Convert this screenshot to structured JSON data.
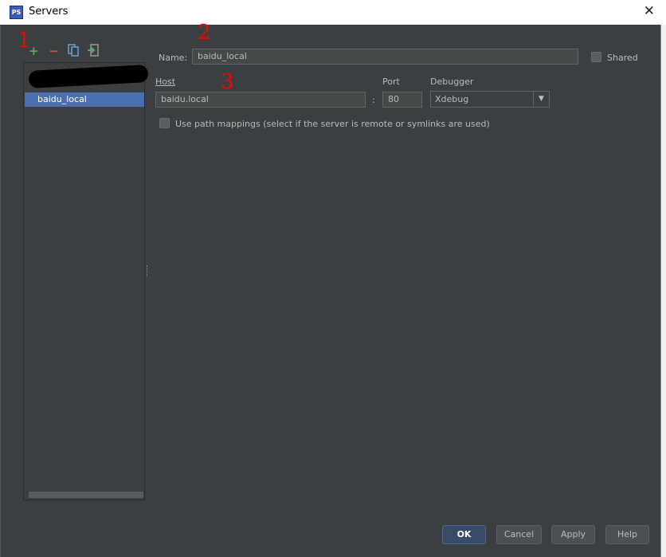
{
  "window": {
    "title": "Servers",
    "close_icon": "close-icon"
  },
  "toolbar": {
    "add": "+",
    "remove": "−",
    "copy_icon": "copy-icon",
    "import_icon": "import-icon"
  },
  "servers": {
    "items": [
      {
        "label": "",
        "redacted": true
      },
      {
        "label": "",
        "redacted": true
      },
      {
        "label": "baidu_local",
        "selected": true
      }
    ]
  },
  "form": {
    "name_label": "Name:",
    "name_value": "baidu_local",
    "shared_label": "Shared",
    "shared_checked": false,
    "host_label": "Host",
    "host_value": "baidu.local",
    "colon": ":",
    "port_label": "Port",
    "port_value": "80",
    "debugger_label": "Debugger",
    "debugger_value": "Xdebug",
    "path_mappings_label": "Use path mappings (select if the server is remote or symlinks are used)",
    "path_mappings_checked": false
  },
  "buttons": {
    "ok": "OK",
    "cancel": "Cancel",
    "apply": "Apply",
    "help": "Help"
  },
  "annotations": [
    "1",
    "2",
    "3"
  ],
  "colors": {
    "background": "#3c3f41",
    "selection": "#4b6eaf",
    "annotation": "#ff0000",
    "add": "#59a869",
    "remove": "#c75450"
  }
}
